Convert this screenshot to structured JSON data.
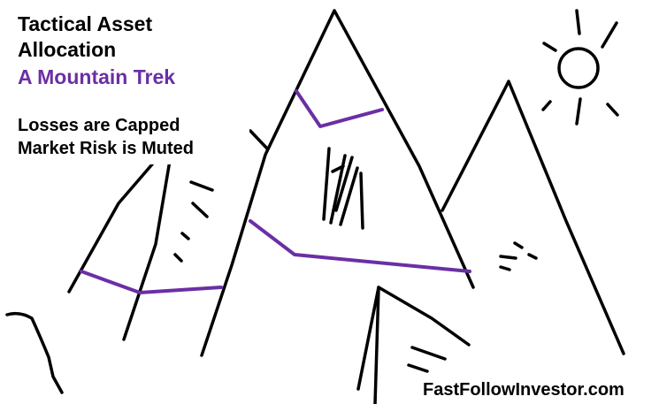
{
  "title": {
    "line1": "Tactical Asset",
    "line2": "Allocation",
    "subtitle": "A Mountain Trek"
  },
  "points": {
    "line1": "Losses are Capped",
    "line2": "Market Risk is Muted"
  },
  "brand": {
    "text": "FastFollowInvestor.com"
  },
  "colors": {
    "ink": "#000000",
    "accent": "#6a2fa5",
    "background": "#ffffff"
  }
}
